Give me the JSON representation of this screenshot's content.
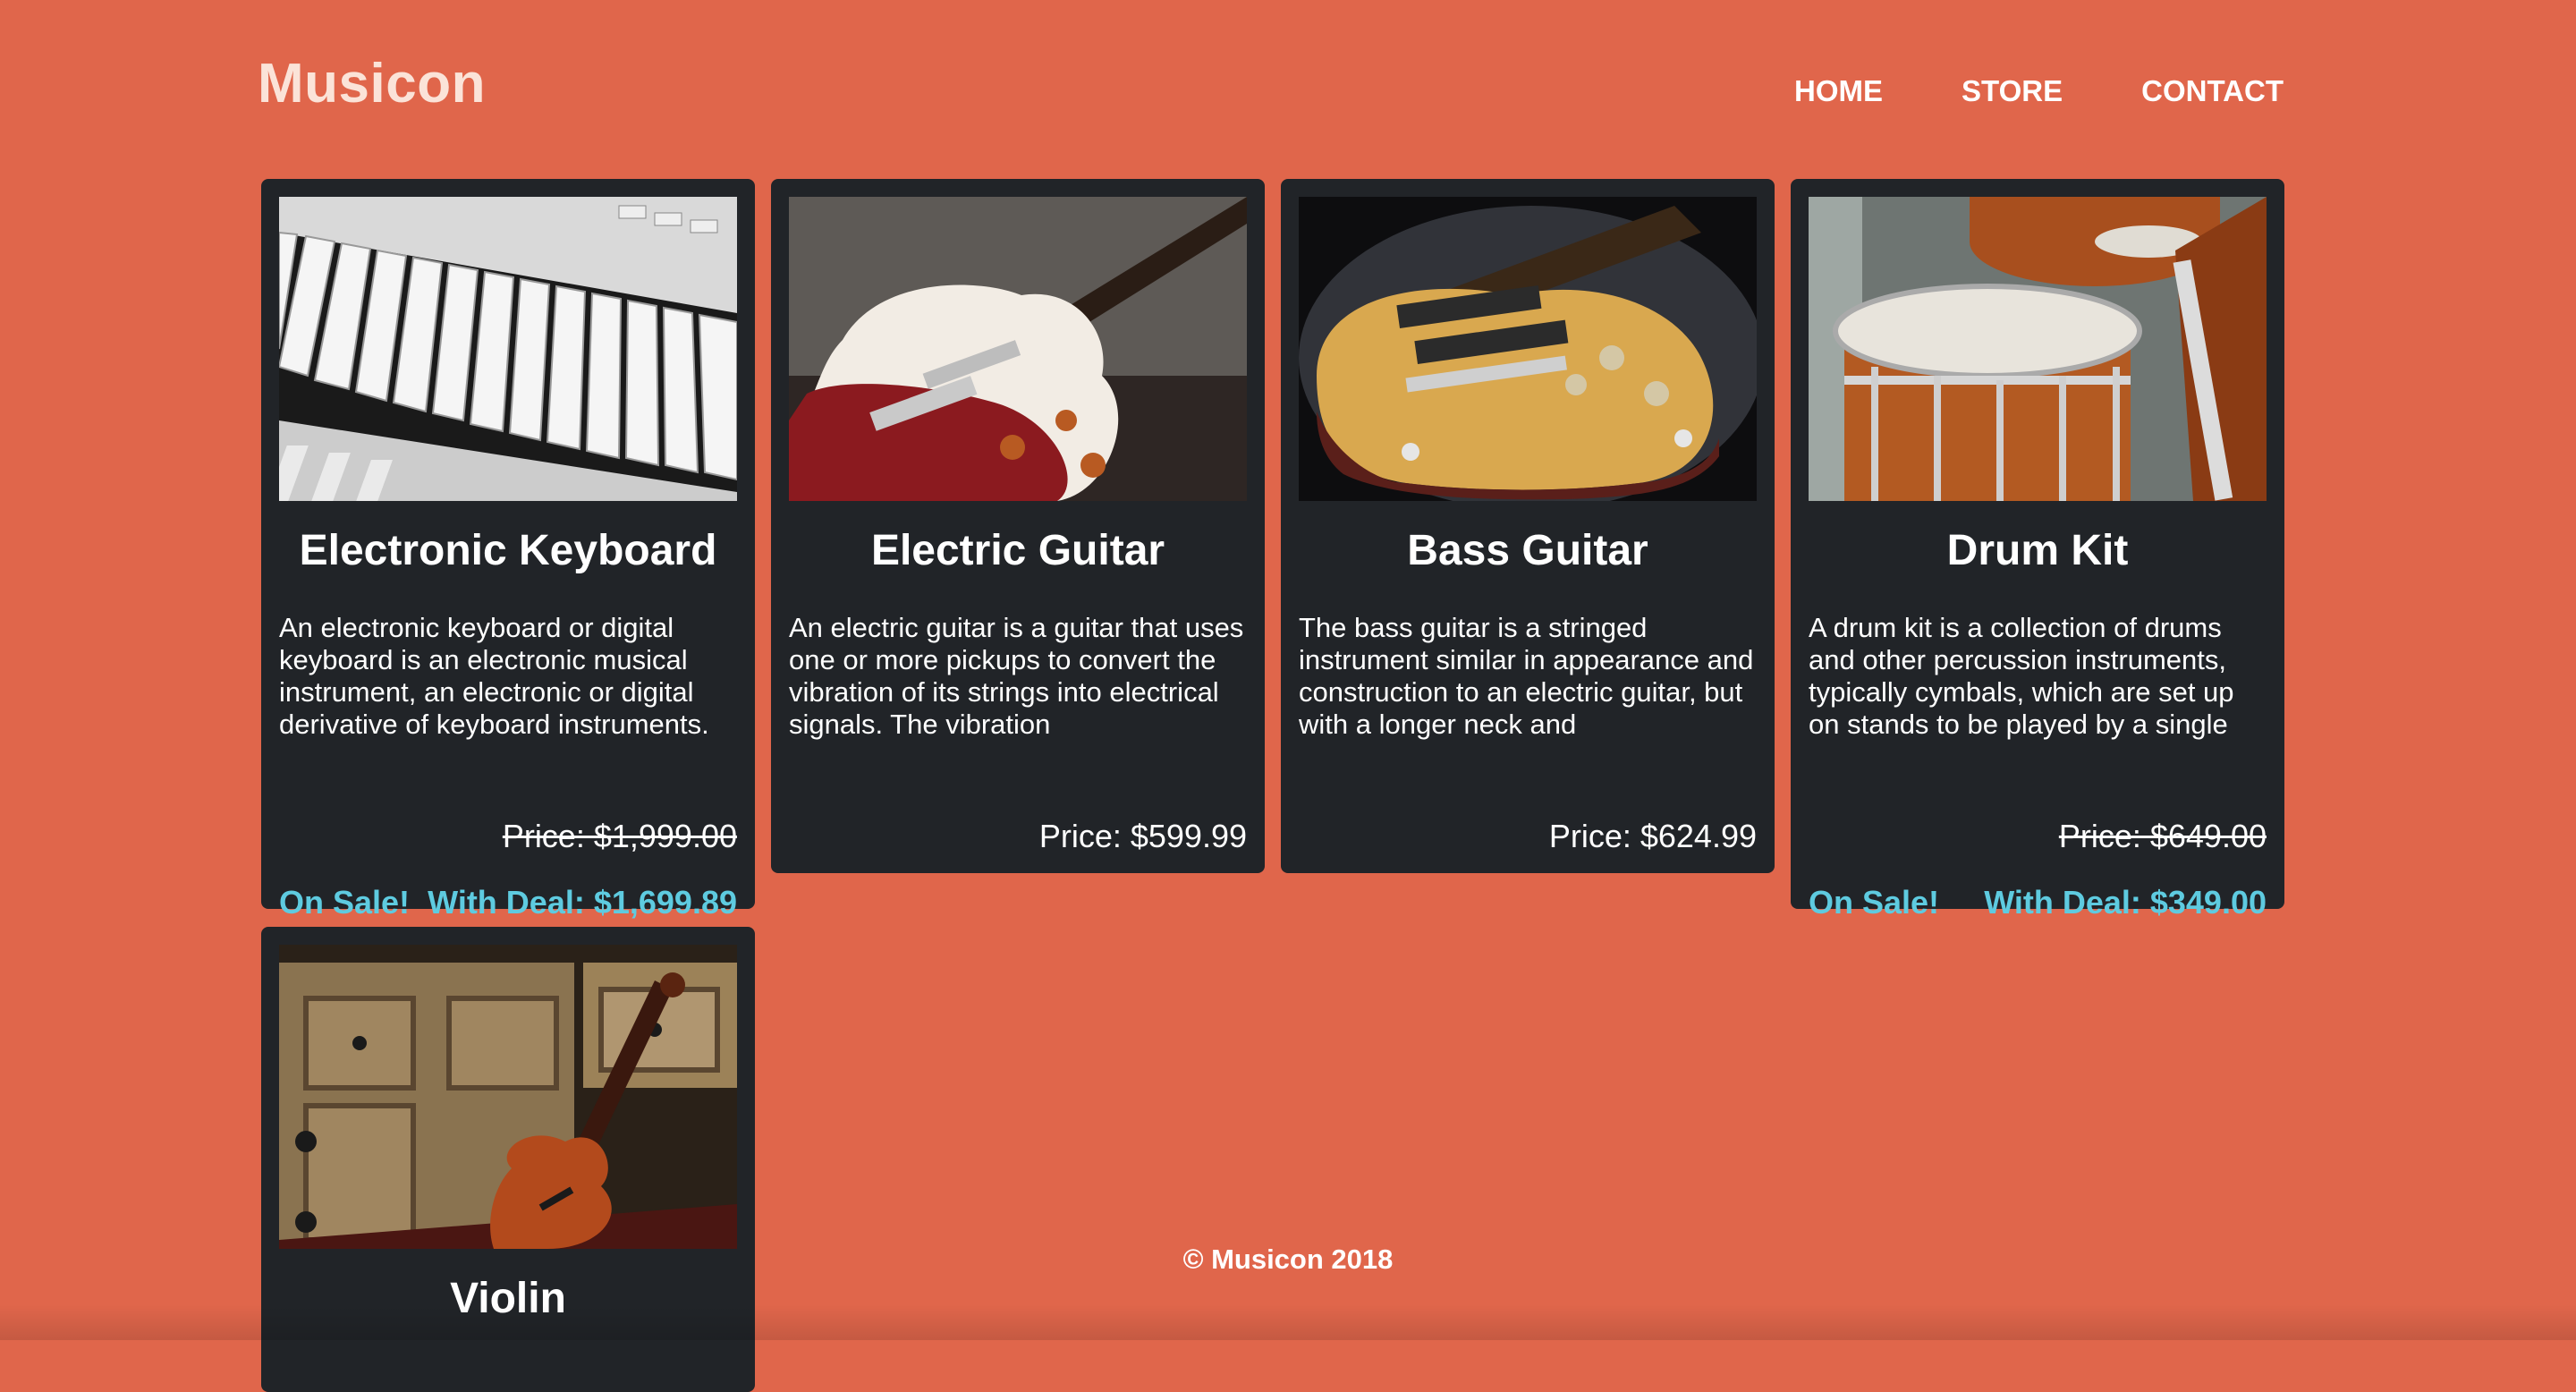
{
  "header": {
    "logo": "Musicon",
    "nav": [
      "HOME",
      "STORE",
      "CONTACT"
    ]
  },
  "products": [
    {
      "name": "Electronic Keyboard",
      "description": "An electronic keyboard or digital keyboard is an electronic musical instrument, an electronic or digital derivative of keyboard instruments.",
      "price": "Price: $1,999.00",
      "on_sale": "On Sale!",
      "deal": "With Deal: $1,699.89"
    },
    {
      "name": "Electric Guitar",
      "description": "An electric guitar is a guitar that uses one or more pickups to convert the vibration of its strings into electrical signals. The vibration",
      "price": "Price: $599.99"
    },
    {
      "name": "Bass Guitar",
      "description": "The bass guitar is a stringed instrument similar in appearance and construction to an electric guitar, but with a longer neck and",
      "price": "Price: $624.99"
    },
    {
      "name": "Drum Kit",
      "description": "A drum kit is a collection of drums and other percussion instruments, typically cymbals, which are set up on stands to be played by a single",
      "price": "Price: $649.00",
      "on_sale": "On Sale!",
      "deal": "With Deal: $349.00"
    },
    {
      "name": "Violin"
    }
  ],
  "footer": "© Musicon 2018",
  "colors": {
    "background": "#e0664b",
    "card": "#212428",
    "accent": "#5ecbe0",
    "logo": "#fbe3d8"
  }
}
